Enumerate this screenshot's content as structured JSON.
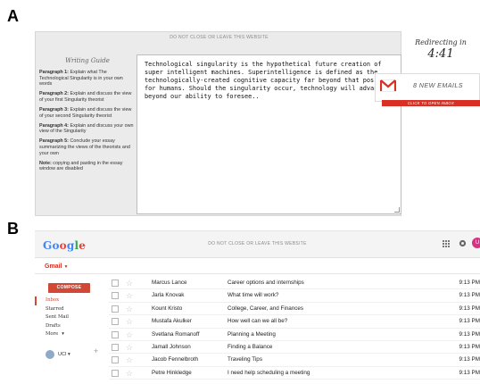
{
  "panels": {
    "a_label": "A",
    "b_label": "B"
  },
  "writing_app": {
    "top_notice": "DO NOT CLOSE OR LEAVE THIS WEBSITE",
    "guide_title": "Writing Guide",
    "guide": [
      {
        "lead": "Paragraph 1:",
        "text": "Explain what The Technological Singularity is in your own words"
      },
      {
        "lead": "Paragraph 2:",
        "text": "Explain and discuss the view of your first Singularity theorist"
      },
      {
        "lead": "Paragraph 3:",
        "text": "Explain and discuss the view of your second Singularity theorist"
      },
      {
        "lead": "Paragraph 4:",
        "text": "Explain and discuss your own view of the Singularity"
      },
      {
        "lead": "Paragraph 5:",
        "text": "Conclude your essay summarizing the views of the theorists and your own"
      },
      {
        "lead": "Note:",
        "text": "copying and pasting in the essay window are disabled"
      }
    ],
    "essay_text": "Technological singularity is the hypothetical future creation of super intelligent machines. Superintelligence is defined as the technologically-created cognitive capacity far beyond that possible for humans. Should the singularity occur, technology will advance beyond our ability to foresee..",
    "redirect_label": "Redirecting in",
    "redirect_timer": "4:41",
    "email_count": "8 NEW EMAILS",
    "open_inbox": "CLICK TO OPEN INBOX"
  },
  "gmail": {
    "logo_letters": [
      "Go",
      "o",
      "g",
      "l",
      "e"
    ],
    "logo_colors": [
      "#4285f4",
      "#ea4335",
      "#4285f4",
      "#34a853",
      "#ea4335"
    ],
    "top_notice": "DO NOT CLOSE OR LEAVE THIS WEBSITE",
    "avatar_initial": "U",
    "product_label": "Gmail",
    "compose_label": "COMPOSE",
    "folders": [
      "Inbox",
      "Starred",
      "Sent Mail",
      "Drafts",
      "More"
    ],
    "more_caret": "▾",
    "hangout_user": "UCI",
    "hangout_caret": "▾",
    "hangout_add": "+",
    "emails": [
      {
        "sender": "Marcus Lance",
        "subject": "Career options and internships",
        "time": "9:13 PM"
      },
      {
        "sender": "Jarla Knovak",
        "subject": "What time will work?",
        "time": "9:13 PM"
      },
      {
        "sender": "Kount Kristo",
        "subject": "College, Career, and Finances",
        "time": "9:13 PM"
      },
      {
        "sender": "Mustafa Akulker",
        "subject": "How well can we all be?",
        "time": "9:13 PM"
      },
      {
        "sender": "Svetlana Romanoff",
        "subject": "Planning a Meeting",
        "time": "9:13 PM"
      },
      {
        "sender": "Jamall Johnson",
        "subject": "Finding a Balance",
        "time": "9:13 PM"
      },
      {
        "sender": "Jacob Fennelbroth",
        "subject": "Traveling Tips",
        "time": "9:13 PM"
      },
      {
        "sender": "Petre Hinkledge",
        "subject": "I need help scheduling a meeting",
        "time": "9:13 PM"
      }
    ]
  }
}
